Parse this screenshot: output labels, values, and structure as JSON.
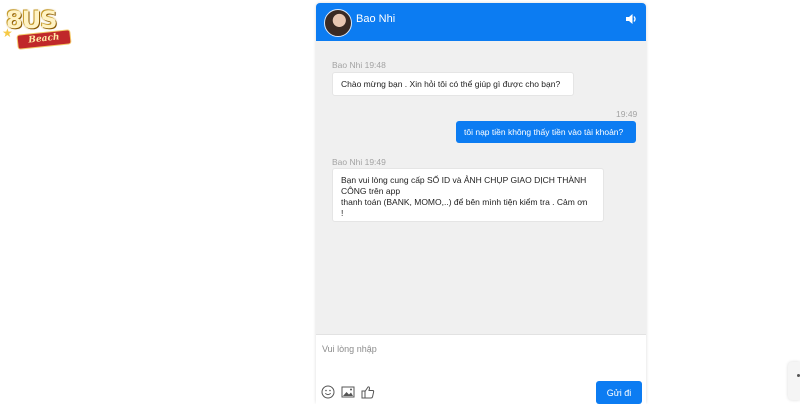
{
  "logo": {
    "brand": "8US",
    "ribbon": "Beach"
  },
  "header": {
    "agent_name": "Bao Nhi",
    "sound_icon": "speaker-icon"
  },
  "messages": [
    {
      "sender": "agent",
      "meta": "Bao Nhi 19:48",
      "lines": [
        "Chào mừng bạn . Xin hỏi tôi có thể giúp gì được cho bạn?"
      ]
    },
    {
      "sender": "user",
      "meta": "19:49",
      "lines": [
        "tôi nạp tiền không thấy tiền vào tài khoản?"
      ]
    },
    {
      "sender": "agent",
      "meta": "Bao Nhi 19:49",
      "lines": [
        "Bạn vui lòng cung cấp SỐ ID và ẢNH CHỤP GIAO DỊCH THÀNH",
        "CÔNG trên app",
        "thanh toán (BANK, MOMO,..) để bên mình tiện kiểm tra . Cảm ơn",
        "!"
      ]
    }
  ],
  "composer": {
    "placeholder": "Vui lòng nhập",
    "icons": [
      "emoji-icon",
      "image-icon",
      "thumbs-up-icon"
    ],
    "send_label": "Gửi đi"
  },
  "colors": {
    "accent": "#0c7cf2",
    "chat_bg": "#f0f0f0"
  }
}
